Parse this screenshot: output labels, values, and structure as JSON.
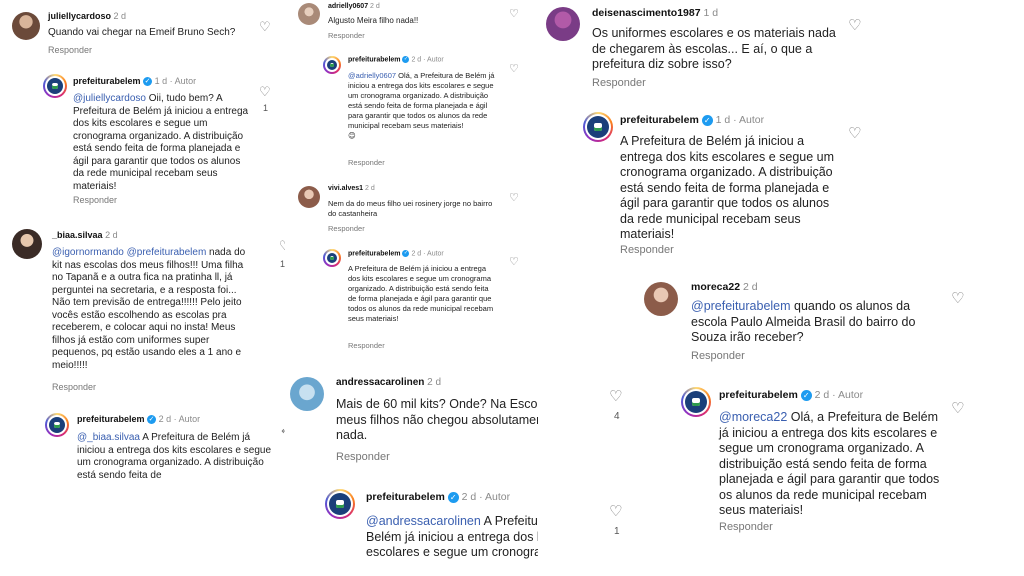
{
  "col1": {
    "c1": {
      "user": "juliellycardoso",
      "time": "2 d",
      "text": "Quando vai chegar na Emeif Bruno Sech?",
      "reply": "Responder"
    },
    "c2": {
      "user": "prefeiturabelem",
      "time": "1 d",
      "author": "Autor",
      "mention": "@juliellycardoso",
      "text": " Oii, tudo bem? A Prefeitura de Belém já iniciou a entrega dos kits escolares e segue um cronograma organizado. A distribuição está sendo feita de forma planejada e ágil para garantir que todos os alunos da rede municipal recebam seus materiais!",
      "reply": "Responder",
      "likes": "1"
    },
    "c3": {
      "user": "_biaa.silvaa",
      "time": "2 d",
      "mention1": "@igornormando",
      "mention2": "@prefeiturabelem",
      "text": " nada do kit nas escolas dos meus filhos!!! Uma filha no Tapanã e a outra fica na pratinha ll, já perguntei na secretaria, e a resposta foi... Não tem previsão de entrega!!!!!! Pelo jeito vocês estão escolhendo as escolas pra receberem, e colocar aqui no insta! Meus filhos já estão com uniformes super pequenos, pq estão usando eles a 1 ano e meio!!!!!",
      "reply": "Responder",
      "likes": "16"
    },
    "c4": {
      "user": "prefeiturabelem",
      "time": "2 d",
      "author": "Autor",
      "mention": "@_biaa.silvaa",
      "text": " A Prefeitura de Belém já iniciou a entrega dos kits escolares e segue um cronograma organizado. A distribuição está sendo feita de"
    }
  },
  "col2": {
    "c1": {
      "user": "adrielly0607",
      "time": "2 d",
      "text": "Algusto Meira filho nada!!",
      "reply": "Responder"
    },
    "c2": {
      "user": "prefeiturabelem",
      "time": "2 d",
      "author": "Autor",
      "mention": "@adrielly0607",
      "text": " Olá, a Prefeitura de Belém já iniciou a entrega dos kits escolares e segue um cronograma organizado. A distribuição está sendo feita de forma planejada e ágil para garantir que todos os alunos da rede municipal recebam seus materiais!",
      "emoji": "😊",
      "reply": "Responder"
    },
    "c3": {
      "user": "vivi.alves1",
      "time": "2 d",
      "text": "Nem da do meus filho uei rosinery jorge no bairro do castanheira",
      "reply": "Responder"
    },
    "c4": {
      "user": "prefeiturabelem",
      "time": "2 d",
      "author": "Autor",
      "text": "A Prefeitura de Belém já iniciou a entrega dos kits escolares e segue um cronograma organizado. A distribuição está sendo feita de forma planejada e ágil para garantir que todos os alunos da rede municipal recebam seus materiais!",
      "reply": "Responder"
    },
    "c5": {
      "user": "andressacarolinen",
      "time": "2 d",
      "text": "Mais de 60 mil kits? Onde? Na Escola dos meus filhos não chegou absolutamente nada.",
      "reply": "Responder",
      "likes": "4"
    },
    "c6": {
      "user": "prefeiturabelem",
      "time": "2 d",
      "author": "Autor",
      "mention": "@andressacarolinen",
      "text": " A Prefeitura de Belém já iniciou a entrega dos kits escolares e segue um cronograma",
      "likes": "1"
    }
  },
  "col3": {
    "c1": {
      "user": "deisenascimento1987",
      "time": "1 d",
      "text": "Os uniformes escolares e os materiais nada de chegarem às escolas... E aí, o que a prefeitura diz sobre isso?",
      "reply": "Responder"
    },
    "c2": {
      "user": "prefeiturabelem",
      "time": "1 d",
      "author": "Autor",
      "text": "A Prefeitura de Belém já iniciou a entrega dos kits escolares e segue um cronograma organizado. A distribuição está sendo feita de forma planejada e ágil para garantir que todos os alunos da rede municipal recebam seus materiais!",
      "reply": "Responder"
    },
    "c3": {
      "user": "moreca22",
      "time": "2 d",
      "mention": "@prefeiturabelem",
      "text": "  quando os alunos da escola Paulo Almeida Brasil do bairro do Souza irão receber?",
      "reply": "Responder"
    },
    "c4": {
      "user": "prefeiturabelem",
      "time": "2 d",
      "author": "Autor",
      "mention": "@moreca22",
      "text": " Olá, a Prefeitura de Belém já iniciou a entrega dos kits escolares e segue um cronograma organizado. A distribuição está sendo feita de forma planejada e ágil para garantir que todos os alunos da rede municipal recebam seus materiais!",
      "reply": "Responder"
    }
  },
  "icons": {
    "heart": "heart-icon",
    "verified": "verified-badge-icon",
    "reply_arrow": "reply-arrow-icon"
  }
}
